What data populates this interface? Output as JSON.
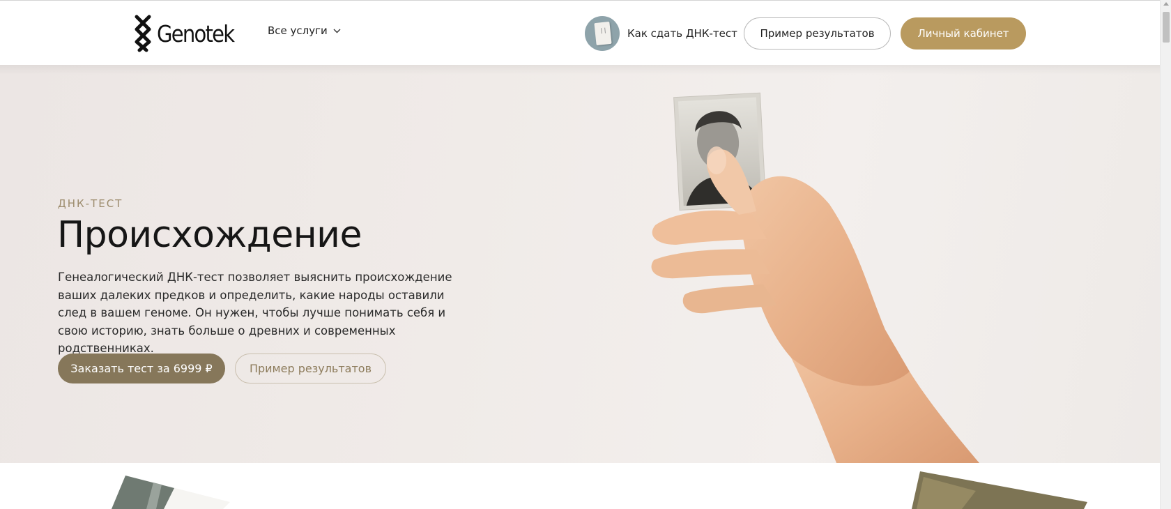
{
  "header": {
    "brand": "Genotek",
    "nav_services": "Все услуги",
    "howto_label": "Как сдать ДНК-тест",
    "results_button": "Пример результатов",
    "cabinet_button": "Личный кабинет"
  },
  "hero": {
    "eyebrow": "ДНК-ТЕСТ",
    "title": "Происхождение",
    "description": "Генеалогический ДНК-тест позволяет выяснить происхождение ваших далеких предков и определить, какие народы оставили след в вашем геноме. Он нужен, чтобы лучше понимать себя и свою историю, знать больше о древних и современных родственниках.",
    "order_button": "Заказать тест за 6999 ₽",
    "results_button": "Пример результатов"
  },
  "icons": [
    "genotek-logo-icon",
    "chevron-down-icon",
    "dna-kit-icon"
  ],
  "colors": {
    "accent_gold": "#b99a5f",
    "order_button": "#86775a",
    "eyebrow": "#9c8b6c",
    "hero_bg": "#f0ebe8"
  }
}
